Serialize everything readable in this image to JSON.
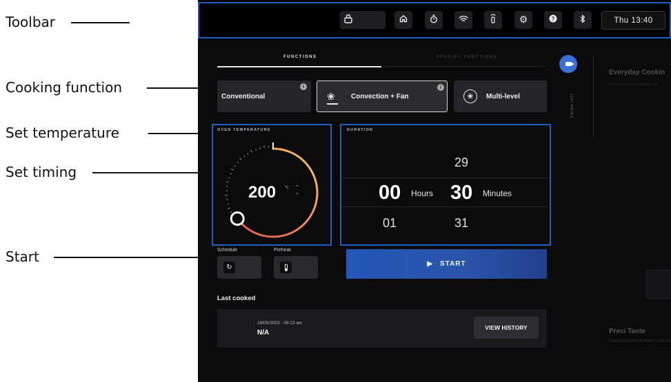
{
  "annotations": {
    "toolbar": "Toolbar",
    "cooking_function": "Cooking function",
    "set_temperature": "Set temperature",
    "set_timing": "Set timing",
    "start": "Start"
  },
  "toolbar": {
    "icons": [
      "lock-icon",
      "home-icon",
      "timer-icon",
      "wifi-icon",
      "remote-icon",
      "gear-icon",
      "help-icon",
      "bluetooth-icon"
    ],
    "clock": "Thu 13:40"
  },
  "tabs": {
    "functions": "FUNCTIONS",
    "special_functions": "SPECIAL FUNCTIONS"
  },
  "functions": {
    "conventional": "Conventional",
    "convection_fan": "Convection + Fan",
    "multi_level": "Multi-level",
    "selected": "Convection + Fan"
  },
  "swipe_hint": "Swipe left",
  "temperature": {
    "title": "OVEN TEMPERATURE",
    "value": "200",
    "unit": "°C",
    "fraction_of_range": 0.65
  },
  "duration": {
    "title": "DURATION",
    "hours_prev": "",
    "hours": "00",
    "hours_next": "01",
    "hours_label": "Hours",
    "minutes_prev": "29",
    "minutes": "30",
    "minutes_next": "31",
    "minutes_label": "Minutes"
  },
  "schedule": {
    "label": "Schedule"
  },
  "preheat": {
    "label": "Preheat"
  },
  "start": {
    "label": "START"
  },
  "last_cooked": {
    "title": "Last cooked",
    "date": "18/05/2023 - 09:23 am",
    "name": "N/A",
    "history_button": "VIEW HISTORY"
  },
  "side_cards": [
    {
      "title": "Everyday Cookin",
      "subtitle": "An everyday cookbook to get"
    },
    {
      "title": "Preci Taste",
      "subtitle": "Explore the new frontier of with Haier's AI"
    }
  ],
  "colors": {
    "highlight": "#1f5fbf",
    "start_button": "#2457b8",
    "accent_blue": "#3c6fd8",
    "dial_gradient_start": "#e85a4f",
    "dial_gradient_end": "#f5c664"
  }
}
